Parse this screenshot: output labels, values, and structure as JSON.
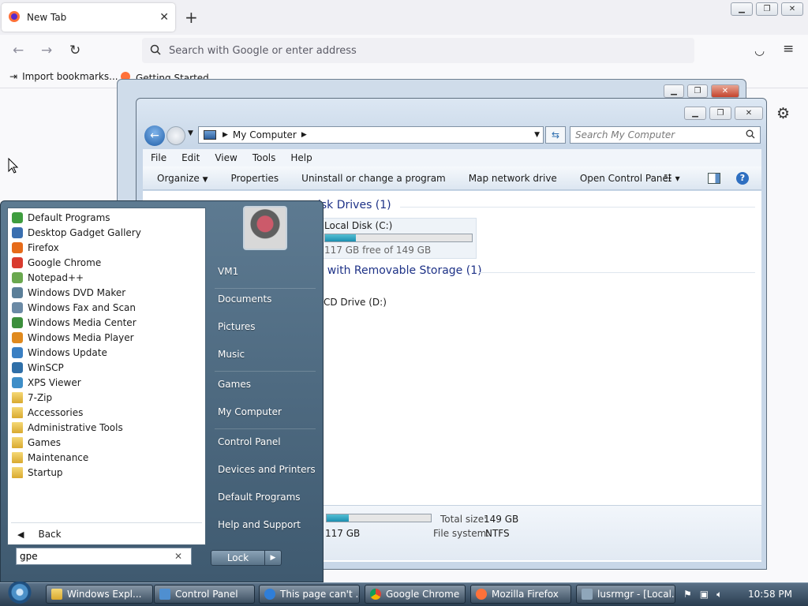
{
  "firefox": {
    "tab_title": "New Tab",
    "tab_close": "✕",
    "new_tab": "+",
    "url_placeholder": "Search with Google or enter address",
    "bookmarks": [
      "Import bookmarks...",
      "Getting Started"
    ]
  },
  "explorer": {
    "address": "My Computer",
    "search_placeholder": "Search My Computer",
    "menu": [
      "File",
      "Edit",
      "View",
      "Tools",
      "Help"
    ],
    "toolbar": [
      "Organize",
      "Properties",
      "Uninstall or change a program",
      "Map network drive",
      "Open Control Panel"
    ],
    "sections": {
      "hdd": "isk Drives (1)",
      "removable": "s with Removable Storage (1)"
    },
    "drives": {
      "c_name": "Local Disk (C:)",
      "c_free": "117 GB free of 149 GB",
      "c_used_fraction": 0.21,
      "d_name": "CD Drive (D:)"
    },
    "details": {
      "free": "117 GB",
      "total_label": "Total size:",
      "total_value": "149 GB",
      "fs_label": "File system:",
      "fs_value": "NTFS"
    }
  },
  "start_menu": {
    "programs": [
      {
        "label": "Default Programs",
        "color": "#3f9d3f"
      },
      {
        "label": "Desktop Gadget Gallery",
        "color": "#3a6fb0"
      },
      {
        "label": "Firefox",
        "color": "#e66b1a"
      },
      {
        "label": "Google Chrome",
        "color": "#d93b2f"
      },
      {
        "label": "Notepad++",
        "color": "#6aa84f"
      },
      {
        "label": "Windows DVD Maker",
        "color": "#5b7f99"
      },
      {
        "label": "Windows Fax and Scan",
        "color": "#6b8aa5"
      },
      {
        "label": "Windows Media Center",
        "color": "#3c8f3c"
      },
      {
        "label": "Windows Media Player",
        "color": "#e08a1e"
      },
      {
        "label": "Windows Update",
        "color": "#3a7fc3"
      },
      {
        "label": "WinSCP",
        "color": "#2f6fa8"
      },
      {
        "label": "XPS Viewer",
        "color": "#3e8ec8"
      }
    ],
    "folders": [
      "7-Zip",
      "Accessories",
      "Administrative Tools",
      "Games",
      "Maintenance",
      "Startup"
    ],
    "back": "Back",
    "search_value": "gpe",
    "search_clear": "✕",
    "right_items": [
      "VM1",
      "Documents",
      "Pictures",
      "Music",
      "Games",
      "My Computer",
      "Control Panel",
      "Devices and Printers",
      "Default Programs",
      "Help and Support"
    ],
    "lock": "Lock"
  },
  "taskbar": {
    "buttons": [
      "Windows Expl...",
      "Control Panel",
      "This page can't ...",
      "Google Chrome",
      "Mozilla Firefox",
      "lusrmgr - [Local..."
    ],
    "clock": "10:58 PM"
  }
}
